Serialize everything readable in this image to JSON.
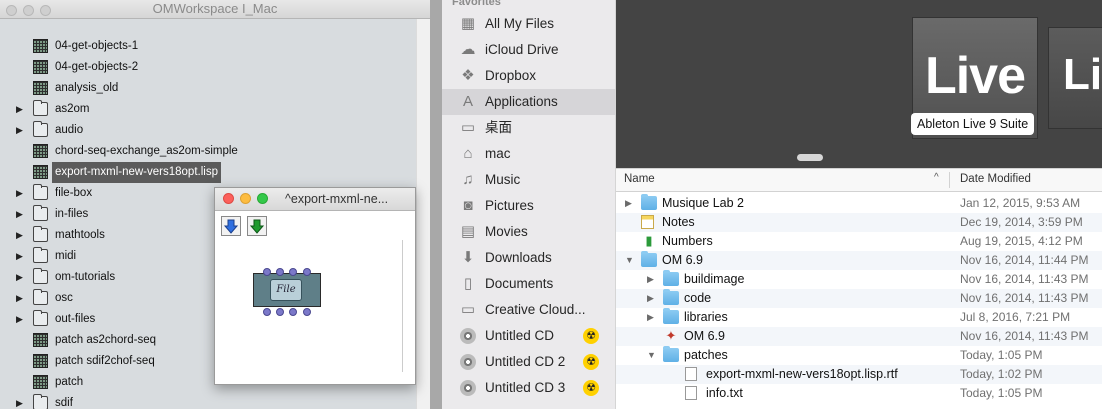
{
  "om_workspace": {
    "title": "OMWorkspace I_Mac",
    "items": [
      {
        "label": "04-get-objects-1",
        "type": "patch",
        "expandable": false
      },
      {
        "label": "04-get-objects-2",
        "type": "patch",
        "expandable": false
      },
      {
        "label": "analysis_old",
        "type": "patch",
        "expandable": false
      },
      {
        "label": "as2om",
        "type": "folder",
        "expandable": true
      },
      {
        "label": "audio",
        "type": "folder",
        "expandable": true
      },
      {
        "label": "chord-seq-exchange_as2om-simple",
        "type": "patch",
        "expandable": false
      },
      {
        "label": "export-mxml-new-vers18opt.lisp",
        "type": "patch",
        "expandable": false,
        "selected": true
      },
      {
        "label": "file-box",
        "type": "folder",
        "expandable": true
      },
      {
        "label": "in-files",
        "type": "folder",
        "expandable": true
      },
      {
        "label": "mathtools",
        "type": "folder",
        "expandable": true
      },
      {
        "label": "midi",
        "type": "folder",
        "expandable": true
      },
      {
        "label": "om-tutorials",
        "type": "folder",
        "expandable": true
      },
      {
        "label": "osc",
        "type": "folder",
        "expandable": true
      },
      {
        "label": "out-files",
        "type": "folder",
        "expandable": true
      },
      {
        "label": "patch as2chord-seq",
        "type": "patch",
        "expandable": false
      },
      {
        "label": "patch sdif2chof-seq",
        "type": "patch",
        "expandable": false
      },
      {
        "label": "patch",
        "type": "patch",
        "expandable": false
      },
      {
        "label": "sdif",
        "type": "folder",
        "expandable": true
      }
    ]
  },
  "patch_window": {
    "title": "^export-mxml-ne...",
    "box_label": "File"
  },
  "finder": {
    "sidebar_heading": "Favorites",
    "sidebar": [
      {
        "label": "All My Files",
        "icon": "all-files-icon",
        "glyph": "▦"
      },
      {
        "label": "iCloud Drive",
        "icon": "cloud-icon",
        "glyph": "☁"
      },
      {
        "label": "Dropbox",
        "icon": "dropbox-icon",
        "glyph": "❖"
      },
      {
        "label": "Applications",
        "icon": "applications-icon",
        "glyph": "A",
        "selected": true
      },
      {
        "label": "桌面",
        "icon": "desktop-icon",
        "glyph": "▭"
      },
      {
        "label": "mac",
        "icon": "home-icon",
        "glyph": "⌂"
      },
      {
        "label": "Music",
        "icon": "music-icon",
        "glyph": "♫"
      },
      {
        "label": "Pictures",
        "icon": "camera-icon",
        "glyph": "◙"
      },
      {
        "label": "Movies",
        "icon": "film-icon",
        "glyph": "▤"
      },
      {
        "label": "Downloads",
        "icon": "download-icon",
        "glyph": "⬇"
      },
      {
        "label": "Documents",
        "icon": "document-icon",
        "glyph": "▯"
      },
      {
        "label": "Creative Cloud...",
        "icon": "folder-icon",
        "glyph": "▭"
      },
      {
        "label": "Untitled CD",
        "icon": "cd-icon",
        "glyph": "",
        "eject": true
      },
      {
        "label": "Untitled CD 2",
        "icon": "cd-icon",
        "glyph": "",
        "eject": true
      },
      {
        "label": "Untitled CD 3",
        "icon": "cd-icon",
        "glyph": "",
        "eject": true
      }
    ],
    "cover_flow_label": "Ableton Live 9 Suite",
    "cover_flow_icon_text": "Live",
    "cover_flow_icon2_text": "Liv",
    "columns": {
      "name": "Name",
      "date": "Date Modified"
    },
    "rows": [
      {
        "name": "Musique Lab 2",
        "date": "Jan 12, 2015, 9:53 AM",
        "icon": "folder",
        "level": 0,
        "disclosure": "closed"
      },
      {
        "name": "Notes",
        "date": "Dec 19, 2014, 3:59 PM",
        "icon": "notes",
        "level": 0,
        "disclosure": "none"
      },
      {
        "name": "Numbers",
        "date": "Aug 19, 2015, 4:12 PM",
        "icon": "numbers",
        "level": 0,
        "disclosure": "none"
      },
      {
        "name": "OM 6.9",
        "date": "Nov 16, 2014, 11:44 PM",
        "icon": "folder",
        "level": 0,
        "disclosure": "open"
      },
      {
        "name": "buildimage",
        "date": "Nov 16, 2014, 11:43 PM",
        "icon": "folder",
        "level": 1,
        "disclosure": "closed"
      },
      {
        "name": "code",
        "date": "Nov 16, 2014, 11:43 PM",
        "icon": "folder",
        "level": 1,
        "disclosure": "closed"
      },
      {
        "name": "libraries",
        "date": "Jul 8, 2016, 7:21 PM",
        "icon": "folder",
        "level": 1,
        "disclosure": "closed"
      },
      {
        "name": "OM 6.9",
        "date": "Nov 16, 2014, 11:43 PM",
        "icon": "om-app",
        "level": 1,
        "disclosure": "none"
      },
      {
        "name": "patches",
        "date": "Today, 1:05 PM",
        "icon": "folder",
        "level": 1,
        "disclosure": "open"
      },
      {
        "name": "export-mxml-new-vers18opt.lisp.rtf",
        "date": "Today, 1:02 PM",
        "icon": "doc",
        "level": 2,
        "disclosure": "none"
      },
      {
        "name": "info.txt",
        "date": "Today, 1:05 PM",
        "icon": "doc",
        "level": 2,
        "disclosure": "none"
      }
    ]
  }
}
